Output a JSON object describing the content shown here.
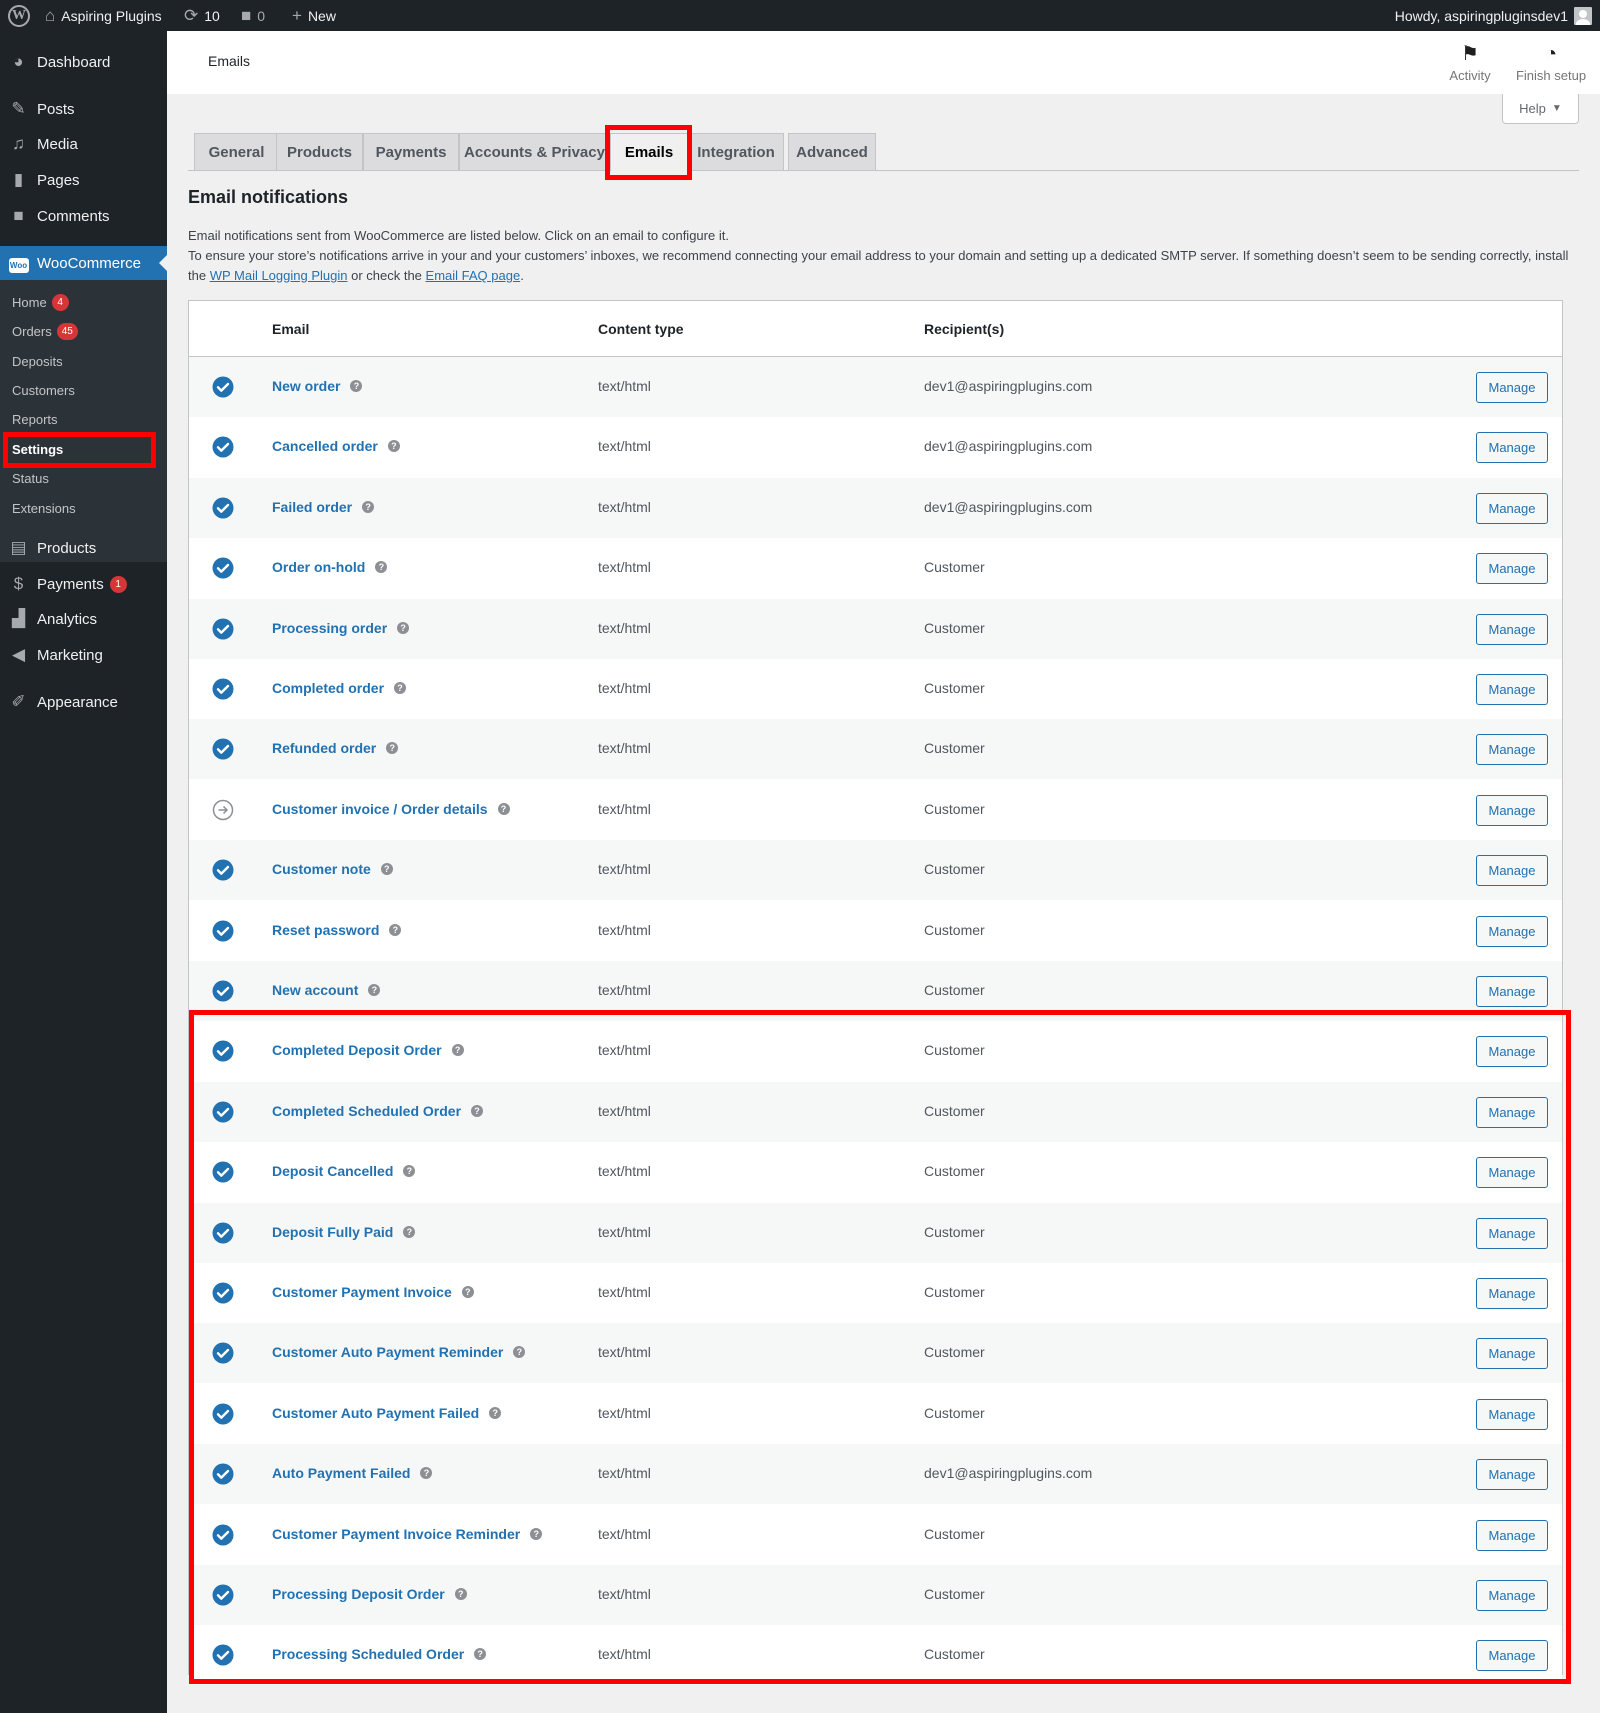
{
  "adminbar": {
    "site_name": "Aspiring Plugins",
    "updates_count": "10",
    "comments_count": "0",
    "new_label": "New",
    "howdy": "Howdy, aspiringpluginsdev1"
  },
  "sidebar": {
    "top_items": [
      {
        "label": "Dashboard",
        "icon": "dashboard-icon"
      },
      {
        "label": "Posts",
        "icon": "pin-icon"
      },
      {
        "label": "Media",
        "icon": "media-icon"
      },
      {
        "label": "Pages",
        "icon": "page-icon"
      },
      {
        "label": "Comments",
        "icon": "comment-icon"
      },
      {
        "label": "WooCommerce",
        "icon": "woo-icon",
        "active": true
      }
    ],
    "woo_submenu": [
      {
        "label": "Home",
        "badge": "4"
      },
      {
        "label": "Orders",
        "badge": "45"
      },
      {
        "label": "Deposits"
      },
      {
        "label": "Customers"
      },
      {
        "label": "Reports"
      },
      {
        "label": "Settings",
        "current": true
      },
      {
        "label": "Status"
      },
      {
        "label": "Extensions"
      }
    ],
    "bottom_items": [
      {
        "label": "Products",
        "icon": "archive-icon"
      },
      {
        "label": "Payments",
        "icon": "dollar-icon",
        "badge": "1"
      },
      {
        "label": "Analytics",
        "icon": "chart-bar-icon"
      },
      {
        "label": "Marketing",
        "icon": "megaphone-icon"
      },
      {
        "label": "Appearance",
        "icon": "paintbrush-icon"
      }
    ]
  },
  "header": {
    "title": "Emails",
    "activity_label": "Activity",
    "finish_setup_label": "Finish setup",
    "help_label": "Help"
  },
  "tabs": [
    {
      "label": "General"
    },
    {
      "label": "Products"
    },
    {
      "label": "Payments"
    },
    {
      "label": "Accounts & Privacy"
    },
    {
      "label": "Emails",
      "active": true
    },
    {
      "label": "Integration"
    },
    {
      "label": "Advanced"
    }
  ],
  "section": {
    "title": "Email notifications",
    "desc_line1": "Email notifications sent from WooCommerce are listed below. Click on an email to configure it.",
    "desc_line2_pre": "To ensure your store’s notifications arrive in your and your customers’ inboxes, we recommend connecting your email address to your domain and setting up a dedicated SMTP server. If something doesn’t seem to be sending correctly, install the ",
    "desc_link1": "WP Mail Logging Plugin",
    "desc_mid": " or check the ",
    "desc_link2": "Email FAQ page",
    "desc_end": "."
  },
  "table": {
    "headers": {
      "email": "Email",
      "content_type": "Content type",
      "recipients": "Recipient(s)"
    },
    "manage_label": "Manage",
    "rows": [
      {
        "name": "New order",
        "content_type": "text/html",
        "recipient": "dev1@aspiringplugins.com",
        "status": "enabled"
      },
      {
        "name": "Cancelled order",
        "content_type": "text/html",
        "recipient": "dev1@aspiringplugins.com",
        "status": "enabled"
      },
      {
        "name": "Failed order",
        "content_type": "text/html",
        "recipient": "dev1@aspiringplugins.com",
        "status": "enabled"
      },
      {
        "name": "Order on-hold",
        "content_type": "text/html",
        "recipient": "Customer",
        "status": "enabled"
      },
      {
        "name": "Processing order",
        "content_type": "text/html",
        "recipient": "Customer",
        "status": "enabled"
      },
      {
        "name": "Completed order",
        "content_type": "text/html",
        "recipient": "Customer",
        "status": "enabled"
      },
      {
        "name": "Refunded order",
        "content_type": "text/html",
        "recipient": "Customer",
        "status": "enabled"
      },
      {
        "name": "Customer invoice / Order details",
        "content_type": "text/html",
        "recipient": "Customer",
        "status": "manual"
      },
      {
        "name": "Customer note",
        "content_type": "text/html",
        "recipient": "Customer",
        "status": "enabled"
      },
      {
        "name": "Reset password",
        "content_type": "text/html",
        "recipient": "Customer",
        "status": "enabled"
      },
      {
        "name": "New account",
        "content_type": "text/html",
        "recipient": "Customer",
        "status": "enabled"
      },
      {
        "name": "Completed Deposit Order",
        "content_type": "text/html",
        "recipient": "Customer",
        "status": "enabled"
      },
      {
        "name": "Completed Scheduled Order",
        "content_type": "text/html",
        "recipient": "Customer",
        "status": "enabled"
      },
      {
        "name": "Deposit Cancelled",
        "content_type": "text/html",
        "recipient": "Customer",
        "status": "enabled"
      },
      {
        "name": "Deposit Fully Paid",
        "content_type": "text/html",
        "recipient": "Customer",
        "status": "enabled"
      },
      {
        "name": "Customer Payment Invoice",
        "content_type": "text/html",
        "recipient": "Customer",
        "status": "enabled"
      },
      {
        "name": "Customer Auto Payment Reminder",
        "content_type": "text/html",
        "recipient": "Customer",
        "status": "enabled"
      },
      {
        "name": "Customer Auto Payment Failed",
        "content_type": "text/html",
        "recipient": "Customer",
        "status": "enabled"
      },
      {
        "name": "Auto Payment Failed",
        "content_type": "text/html",
        "recipient": "dev1@aspiringplugins.com",
        "status": "enabled"
      },
      {
        "name": "Customer Payment Invoice Reminder",
        "content_type": "text/html",
        "recipient": "Customer",
        "status": "enabled"
      },
      {
        "name": "Processing Deposit Order",
        "content_type": "text/html",
        "recipient": "Customer",
        "status": "enabled"
      },
      {
        "name": "Processing Scheduled Order",
        "content_type": "text/html",
        "recipient": "Customer",
        "status": "enabled"
      }
    ]
  },
  "colors": {
    "accent": "#2271b1",
    "highlight": "#ff0000",
    "sidebar": "#1d2327"
  }
}
